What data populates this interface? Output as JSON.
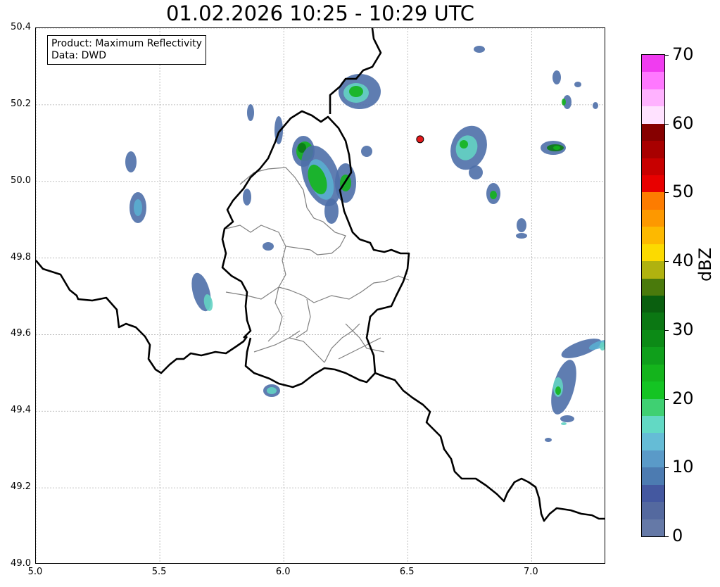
{
  "title": "01.02.2026 10:25 - 10:29 UTC",
  "info": {
    "product": "Product: Maximum Reflectivity",
    "data": "Data: DWD"
  },
  "axes": {
    "x_ticks": [
      "5.0",
      "5.5",
      "6.0",
      "6.5",
      "7.0"
    ],
    "y_ticks": [
      "50.4",
      "50.2",
      "50.0",
      "49.8",
      "49.6",
      "49.4",
      "49.2",
      "49.0"
    ],
    "xlim": [
      5.0,
      7.3
    ],
    "ylim": [
      49.0,
      50.4
    ],
    "grid": true
  },
  "colorbar": {
    "label": "dBZ",
    "tick_labels": [
      "0",
      "10",
      "20",
      "30",
      "40",
      "50",
      "60",
      "70"
    ],
    "range": [
      0,
      70
    ],
    "colors": [
      "#6579a7",
      "#54699f",
      "#4458a0",
      "#4c7bb1",
      "#5a9ac8",
      "#65bcd6",
      "#62d9c4",
      "#3fd072",
      "#14c423",
      "#14b41c",
      "#0f9f1b",
      "#0c8a16",
      "#0b7713",
      "#0a5f0f",
      "#4a7a0c",
      "#b0b20f",
      "#fcda00",
      "#fdb900",
      "#fd9800",
      "#fd7c00",
      "#e80000",
      "#c80000",
      "#a80000",
      "#860000",
      "#ffe2ff",
      "#ffb2ff",
      "#ff78ff",
      "#f03cf0"
    ]
  },
  "marker": {
    "lon": 6.55,
    "lat": 50.11,
    "color": "#e41a1c"
  },
  "reflectivity_colors": {
    "low": "#4e6fa8",
    "mid": "#5aaed0",
    "cyan": "#64d3c3",
    "green": "#14b41c",
    "dark_green": "#0a7a14"
  }
}
